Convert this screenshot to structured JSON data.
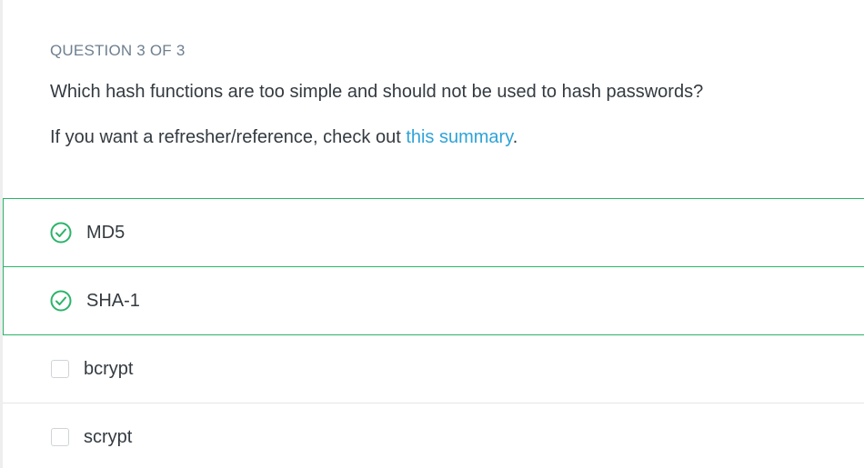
{
  "quiz": {
    "counter": "QUESTION 3 OF 3",
    "question": "Which hash functions are too simple and should not be used to hash passwords?",
    "hint_prefix": "If you want a refresher/reference, check out ",
    "hint_link": "this summary",
    "hint_suffix": "."
  },
  "options": [
    {
      "label": "MD5",
      "selected": true,
      "icon": "check-circle-icon"
    },
    {
      "label": "SHA-1",
      "selected": true,
      "icon": "check-circle-icon"
    },
    {
      "label": "bcrypt",
      "selected": false,
      "icon": "checkbox-icon"
    },
    {
      "label": "scrypt",
      "selected": false,
      "icon": "checkbox-icon"
    }
  ],
  "colors": {
    "accent_green": "#2bb46a",
    "link_blue": "#2ea3d8",
    "muted_text": "#6e7f8f",
    "body_text": "#333a40"
  }
}
